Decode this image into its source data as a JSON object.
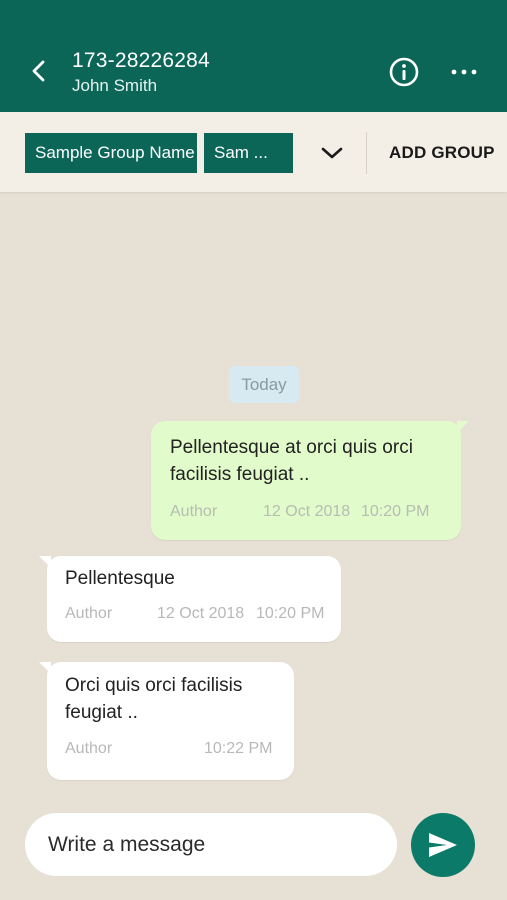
{
  "header": {
    "phone_number": "173-28226284",
    "contact_name": "John Smith",
    "back_icon": "chevron-left-icon",
    "info_icon": "info-circle-icon",
    "more_icon": "more-horizontal-icon"
  },
  "group_bar": {
    "chips": [
      "Sample Group Name",
      "Sam ..."
    ],
    "dropdown_icon": "chevron-down-icon",
    "add_group_label": "ADD GROUP"
  },
  "conversation": {
    "date_separator": "Today",
    "messages": [
      {
        "direction": "outgoing",
        "text": "Pellentesque at orci quis orci facilisis feugiat ..",
        "author": "Author",
        "date": "12 Oct 2018",
        "time": "10:20 PM"
      },
      {
        "direction": "incoming",
        "text": "Pellentesque",
        "author": "Author",
        "date": "12 Oct 2018",
        "time": "10:20 PM"
      },
      {
        "direction": "incoming",
        "text": "Orci quis orci facilisis feugiat ..",
        "author": "Author",
        "time": "10:22 PM"
      }
    ]
  },
  "composer": {
    "placeholder": "Write a message",
    "send_icon": "send-icon"
  },
  "colors": {
    "primary": "#0b6657",
    "send_button": "#0b7a69",
    "chat_background": "#e7e0d4",
    "outgoing_bubble": "#e1fbcb",
    "incoming_bubble": "#ffffff",
    "date_chip": "#d7e9f1"
  }
}
